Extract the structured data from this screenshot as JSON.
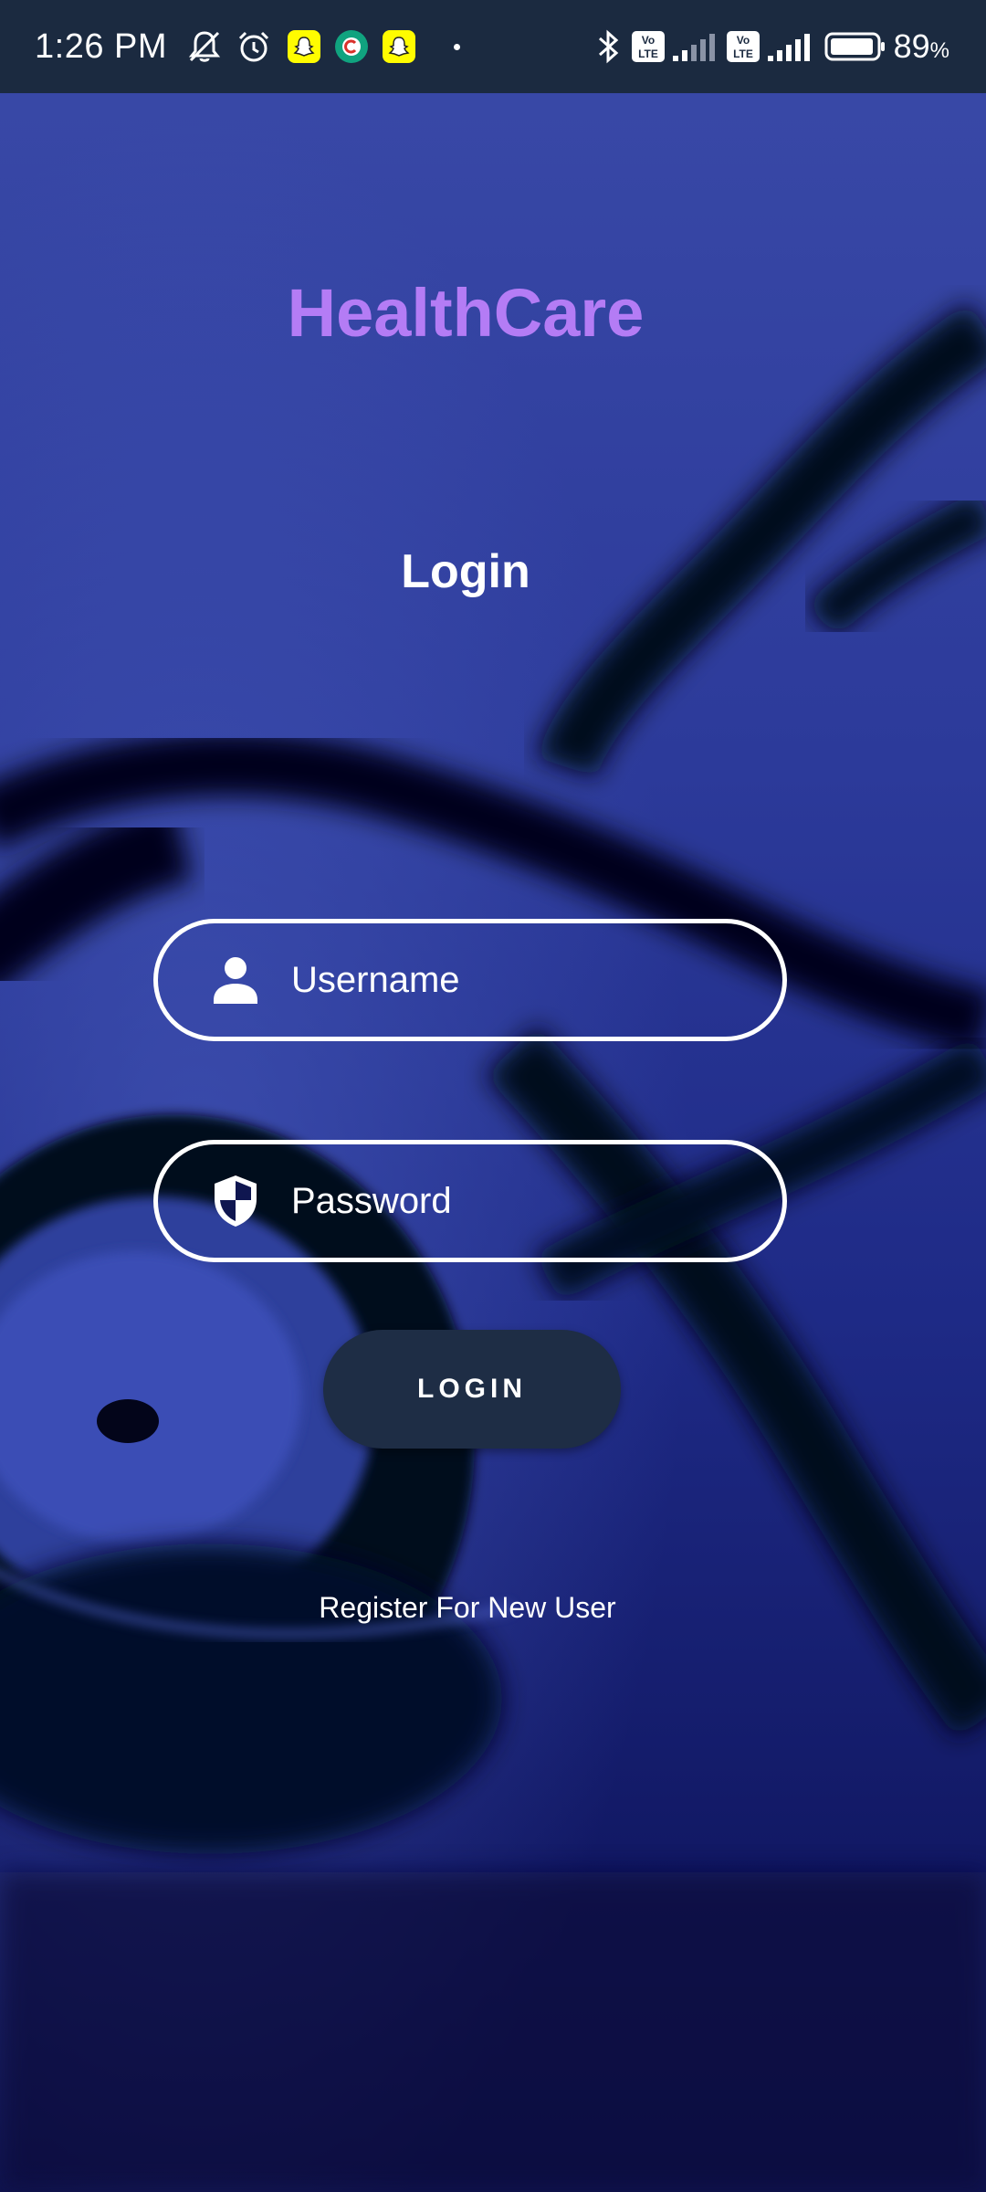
{
  "status_bar": {
    "time": "1:26 PM",
    "battery_percent": "89",
    "battery_unit": "%",
    "icons": [
      "mute-bell-icon",
      "alarm-icon",
      "snapchat-icon",
      "app-c-icon",
      "snapchat-icon",
      "bluetooth-icon",
      "volte-icon",
      "signal-icon",
      "volte-icon",
      "signal-icon",
      "battery-icon"
    ]
  },
  "app": {
    "title": "HealthCare",
    "heading": "Login"
  },
  "form": {
    "username_placeholder": "Username",
    "password_placeholder": "Password",
    "login_label": "LOGIN",
    "register_label": "Register For New User"
  },
  "colors": {
    "title": "#b47cf5",
    "status_bar": "#1b2a40",
    "button": "#1e2d45",
    "background": "#0c1040"
  }
}
